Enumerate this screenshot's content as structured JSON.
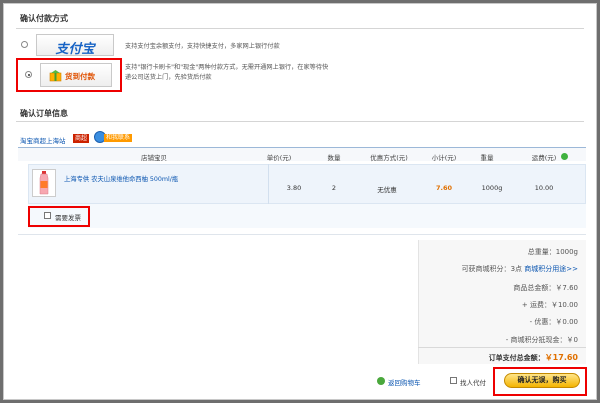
{
  "payment": {
    "title": "确认付款方式",
    "alipay": {
      "logo_text": "支付宝",
      "desc": "支持支付宝余额支付，支持快捷支付，多家网上银行付款"
    },
    "cod": {
      "logo_text": "货到付款",
      "desc_line1": "支持\"银行卡刷卡\"和\"现金\"两种付款方式，无需开通网上银行，在家等待快",
      "desc_line2": "递公司送货上门，先验货后付款"
    }
  },
  "order": {
    "title": "确认订单信息",
    "shop_name": "淘宝商超上海站",
    "shop_badge": "商超",
    "contact_label": "和我联系",
    "headers": {
      "item": "店铺宝贝",
      "unit_price": "单价(元)",
      "quantity": "数量",
      "discount": "优惠方式(元)",
      "subtotal": "小计(元)",
      "weight": "重量",
      "shipping": "运费(元)"
    },
    "item": {
      "name": "上海专供 农夫山泉维他命西柚 500ml/瓶",
      "unit_price": "3.80",
      "quantity": "2",
      "discount": "无优惠",
      "subtotal": "7.60",
      "weight": "1000g",
      "shipping": "10.00"
    },
    "invoice_label": "需要发票"
  },
  "summary": {
    "total_weight_label": "总重量：",
    "total_weight_value": "1000g",
    "points_label": "可获商城积分：",
    "points_value": "3点",
    "points_link": "商城积分用途>>",
    "goods_total_label": "商品总金额：",
    "goods_total_value": "￥7.60",
    "shipping_label": "+ 运费：",
    "shipping_value": "￥10.00",
    "discount_label": "- 优惠：",
    "discount_value": "￥0.00",
    "points_cash_label": "- 商城积分抵现金：",
    "points_cash_value": "￥0",
    "pay_total_label": "订单支付总金额：",
    "pay_total_value": "￥17.60"
  },
  "footer": {
    "back_to_cart": "返回购物车",
    "proxy_pay": "找人代付",
    "confirm_button": "确认无误，购买"
  },
  "colors": {
    "link": "#0a55b0",
    "price_orange": "#e07000",
    "highlight_red": "#ee0000",
    "button_yellow": "#f4b400"
  }
}
